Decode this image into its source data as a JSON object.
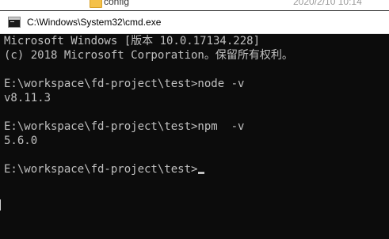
{
  "background_explorer": {
    "folder_name": "config",
    "folder_date": "2020/2/10 10:14"
  },
  "window": {
    "title": "C:\\Windows\\System32\\cmd.exe"
  },
  "console": {
    "lines": [
      "Microsoft Windows [版本 10.0.17134.228]",
      "(c) 2018 Microsoft Corporation。保留所有权利。",
      "",
      "E:\\workspace\\fd-project\\test>node -v",
      "v8.11.3",
      "",
      "E:\\workspace\\fd-project\\test>npm  -v",
      "5.6.0",
      "",
      "E:\\workspace\\fd-project\\test>"
    ]
  },
  "colors": {
    "console_bg": "#0c0c0c",
    "console_text": "#c0c0c0",
    "titlebar_bg": "#ffffff"
  }
}
